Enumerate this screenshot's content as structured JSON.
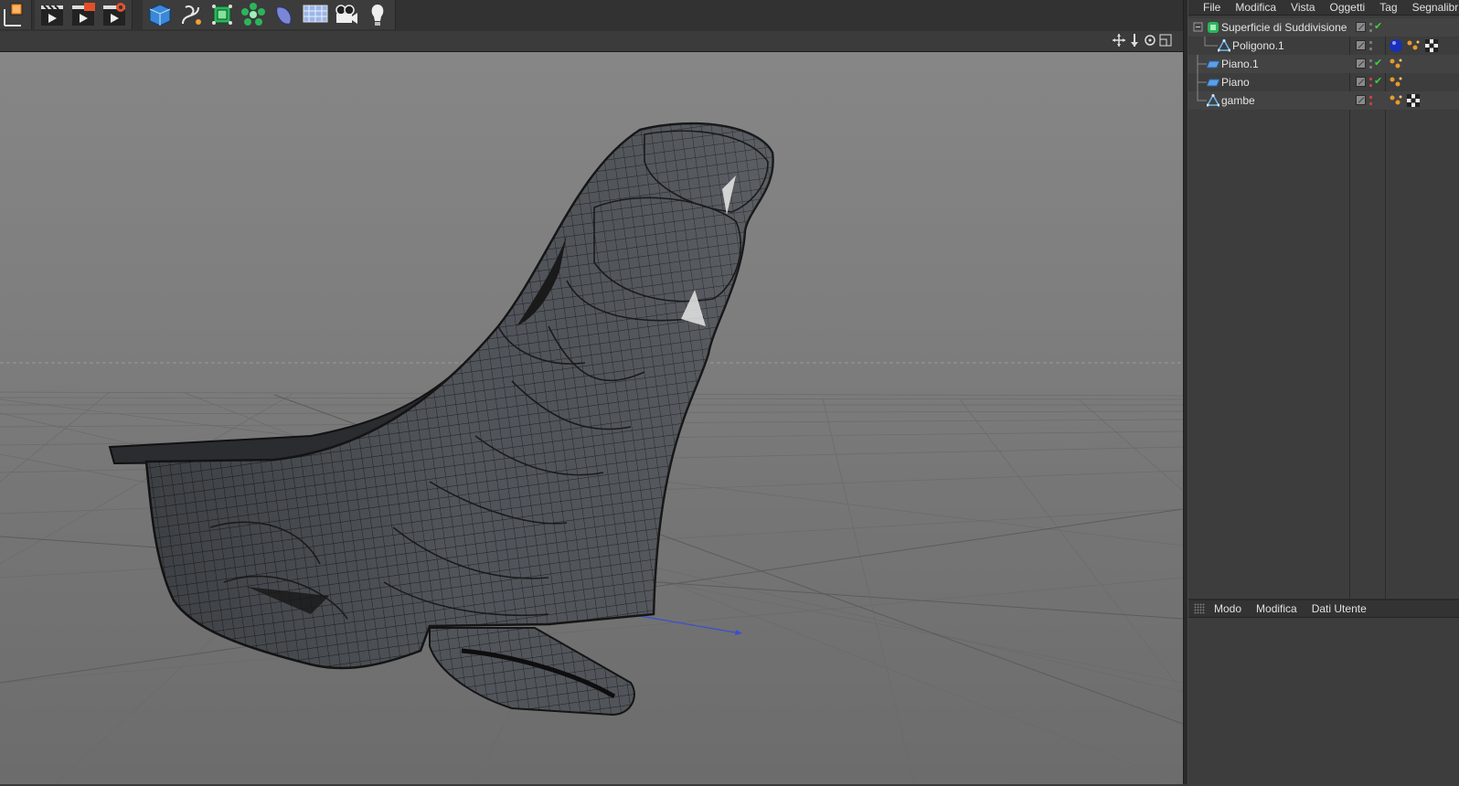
{
  "toolbar": {
    "icons": [
      {
        "name": "coordinate-system-icon"
      },
      {
        "name": "render-view-icon"
      },
      {
        "name": "render-to-picture-viewer-icon"
      },
      {
        "name": "render-settings-icon"
      },
      {
        "name": "cube-primitive-icon"
      },
      {
        "name": "spline-pen-icon"
      },
      {
        "name": "subdivision-surface-icon"
      },
      {
        "name": "array-generator-icon"
      },
      {
        "name": "deformer-icon"
      },
      {
        "name": "floor-scene-icon"
      },
      {
        "name": "camera-icon"
      },
      {
        "name": "light-icon"
      }
    ]
  },
  "object_manager": {
    "menu": [
      "File",
      "Modifica",
      "Vista",
      "Oggetti",
      "Tag",
      "Segnalibri"
    ],
    "objects": [
      {
        "label": "Superficie di Suddivisione",
        "icon": "subdivision-surface-icon",
        "enabled_check": true,
        "tags": []
      },
      {
        "label": "Poligono.1",
        "icon": "polygon-object-icon",
        "enabled_check": false,
        "tags": [
          "material-sphere-icon",
          "phong-tag-icon",
          "checker-texture-icon"
        ]
      },
      {
        "label": "Piano.1",
        "icon": "plane-object-icon",
        "enabled_check": true,
        "tags": [
          "phong-tag-icon"
        ]
      },
      {
        "label": "Piano",
        "icon": "plane-object-icon",
        "enabled_check": true,
        "tags": [
          "phong-tag-icon"
        ]
      },
      {
        "label": "gambe",
        "icon": "polygon-object-icon",
        "enabled_check": false,
        "tags": [
          "phong-tag-icon",
          "checker-texture-icon"
        ]
      }
    ]
  },
  "attribute_manager": {
    "menu": [
      "Modo",
      "Modifica",
      "Dati Utente"
    ]
  },
  "colors": {
    "panel_bg": "#3d3d3d",
    "viewport_bg": "#7c7c7c",
    "mesh_fill": "#4f5257",
    "mesh_wire": "#1f2022",
    "check_green": "#3fcf3f",
    "axis_x": "#cc2222",
    "axis_z": "#3a4fd0"
  }
}
